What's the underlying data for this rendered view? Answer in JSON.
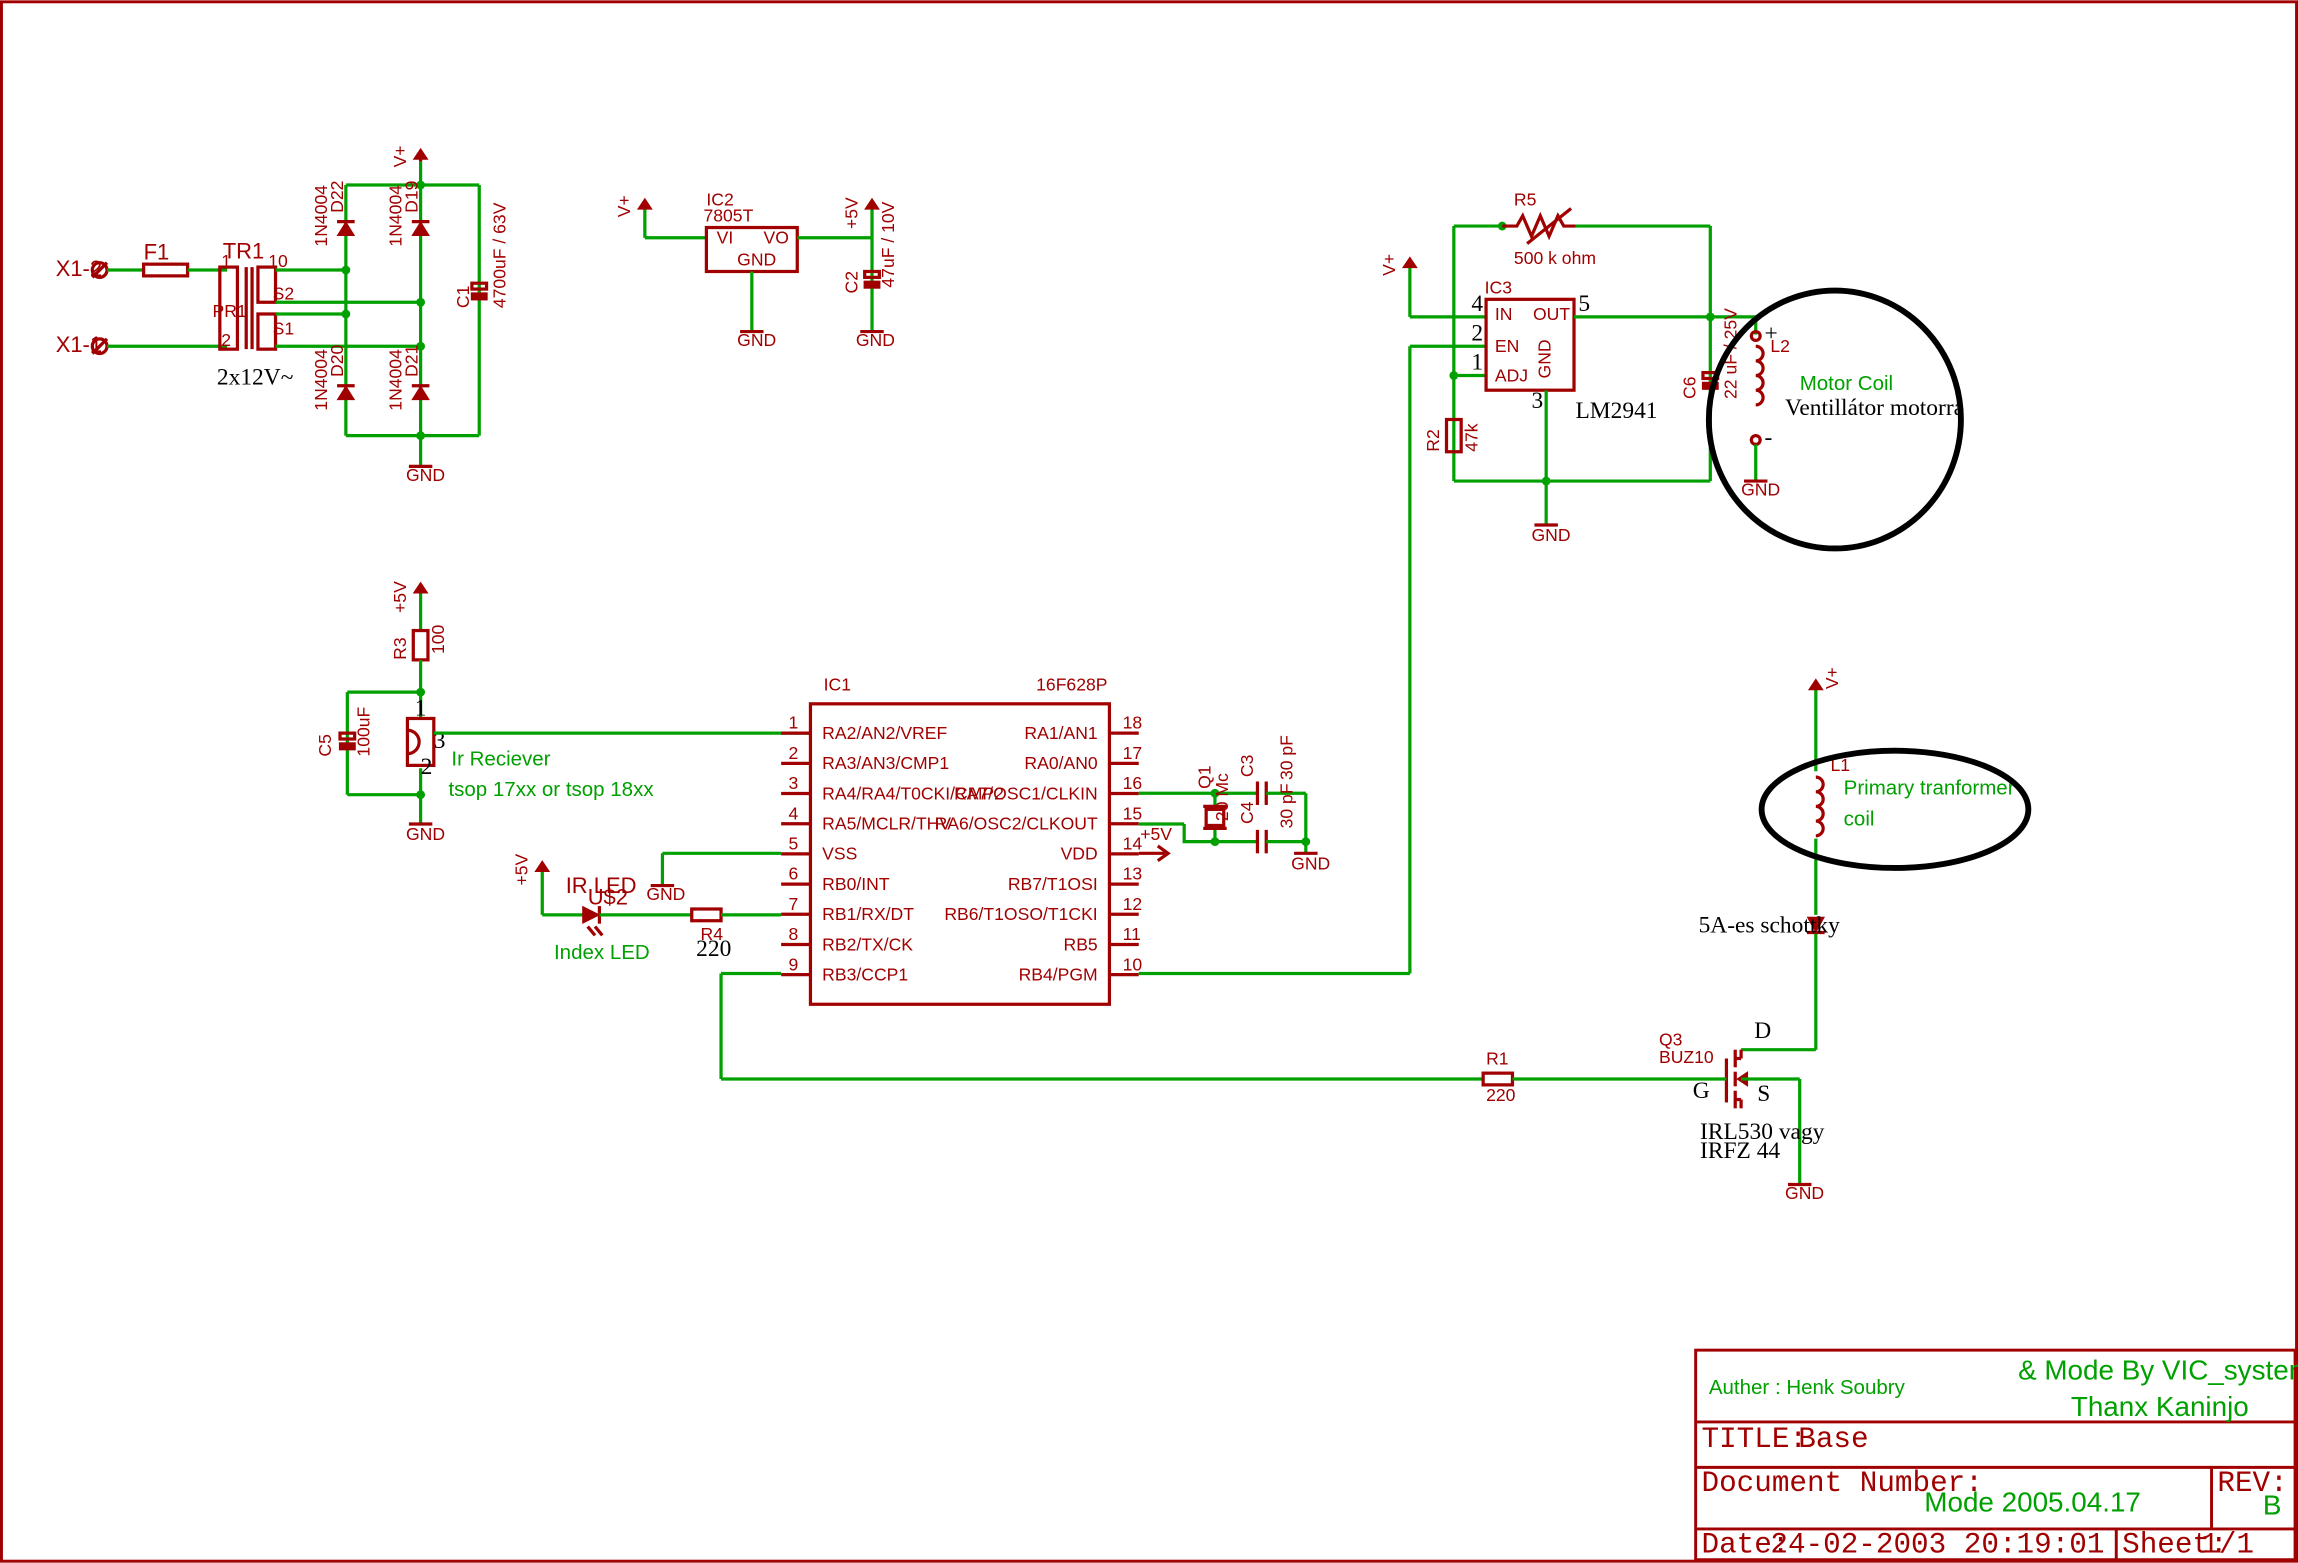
{
  "frame": {
    "color_wire": "#00a000",
    "color_part": "#a00000",
    "color_note": "#000000"
  },
  "power": {
    "x12": "X1-2",
    "x11": "X1-1",
    "f1": "F1",
    "tr1": "TR1",
    "tr_ratio": "2x12V~",
    "tr_pin1": "1",
    "tr_pin10": "10",
    "tr_pin2": "2",
    "tr_pr": "PR1",
    "tr_s2": "S2",
    "tr_s1": "S1",
    "d22": "D22",
    "d19": "D19",
    "d20": "D20",
    "d21": "D21",
    "diode_type": "1N4004",
    "c1": "C1",
    "c1_val": "4700uF / 63V",
    "vplus": "V+",
    "gnd": "GND"
  },
  "reg": {
    "vplus": "V+",
    "ic2": "IC2",
    "ic2_type": "7805T",
    "vi": "VI",
    "vo": "VO",
    "gnd_in": "GND",
    "plus5": "+5V",
    "c2": "C2",
    "c2_val": "47uF / 10V",
    "gnd": "GND"
  },
  "motor": {
    "r5": "R5",
    "r5_val": "500 k ohm",
    "vplus": "V+",
    "ic3": "IC3",
    "in": "IN",
    "out": "OUT",
    "en": "EN",
    "adj": "ADJ",
    "gnd_pin": "GND",
    "p4": "4",
    "p2": "2",
    "p1": "1",
    "p5": "5",
    "p3": "3",
    "lm": "LM2941",
    "r2": "R2",
    "r2_val": "47k",
    "c6": "C6",
    "c6_val": "22 uF / 25V",
    "l2": "L2",
    "plus": "+",
    "minus": "-",
    "coil_label": "Motor Coil",
    "coil_note": "Ventillátor motorra",
    "gnd": "GND",
    "gnd2": "GND"
  },
  "ir": {
    "plus5": "+5V",
    "r3": "R3",
    "r3_val": "100",
    "c5": "C5",
    "c5_val": "100uF",
    "p1": "1",
    "p2": "2",
    "p3": "3",
    "recv": "Ir Reciever",
    "recv_type": "tsop 17xx or tsop 18xx",
    "gnd": "GND"
  },
  "mcu": {
    "ic1": "IC1",
    "type": "16F628P",
    "left_pins": [
      {
        "num": "1",
        "name": "RA2/AN2/VREF"
      },
      {
        "num": "2",
        "name": "RA3/AN3/CMP1"
      },
      {
        "num": "3",
        "name": "RA4/RA4/T0CKI/CMP2"
      },
      {
        "num": "4",
        "name": "RA5/MCLR/THV"
      },
      {
        "num": "5",
        "name": "VSS"
      },
      {
        "num": "6",
        "name": "RB0/INT"
      },
      {
        "num": "7",
        "name": "RB1/RX/DT"
      },
      {
        "num": "8",
        "name": "RB2/TX/CK"
      },
      {
        "num": "9",
        "name": "RB3/CCP1"
      }
    ],
    "right_pins": [
      {
        "num": "18",
        "name": "RA1/AN1"
      },
      {
        "num": "17",
        "name": "RA0/AN0"
      },
      {
        "num": "16",
        "name": "RA7/OSC1/CLKIN"
      },
      {
        "num": "15",
        "name": "RA6/OSC2/CLKOUT"
      },
      {
        "num": "14",
        "name": "VDD"
      },
      {
        "num": "13",
        "name": "RB7/T1OSI"
      },
      {
        "num": "12",
        "name": "RB6/T1OSO/T1CKI"
      },
      {
        "num": "11",
        "name": "RB5"
      },
      {
        "num": "10",
        "name": "RB4/PGM"
      }
    ],
    "plus5": "+5V",
    "gnd": "GND"
  },
  "osc": {
    "q1": "Q1",
    "q1_val": "20 Mc",
    "c3": "C3",
    "c3_val": "30 pF",
    "c4": "C4",
    "c4_val": "30 pF",
    "gnd": "GND"
  },
  "led": {
    "plus5": "+5V",
    "irled": "IR LED",
    "u2": "U$2",
    "index": "Index LED",
    "r4": "R4",
    "r4_val": "220",
    "gnd": "GND"
  },
  "drive": {
    "vplus": "V+",
    "l1": "L1",
    "coil_label": "Primary tranformer",
    "coil_label2": "coil",
    "schottky": "5A-es schottky",
    "q3": "Q3",
    "q3_type": "BUZ10",
    "d": "D",
    "g": "G",
    "s": "S",
    "alt1": "IRL530 vagy",
    "alt2": "IRFZ 44",
    "r1": "R1",
    "r1_val": "220",
    "gnd": "GND"
  },
  "titleblock": {
    "author": "Auther : Henk Soubry",
    "mode_by": "& Mode By VIC_system",
    "thanx": "Thanx Kaninjo",
    "title_label": "TITLE:",
    "title": "Base",
    "docnum_label": "Document Number:",
    "docnum": "Mode 2005.04.17",
    "rev_label": "REV:",
    "rev": "B",
    "date_label": "Date:",
    "date": "24-02-2003 20:19:01",
    "sheet_label": "Sheet:",
    "sheet": "1/1"
  }
}
